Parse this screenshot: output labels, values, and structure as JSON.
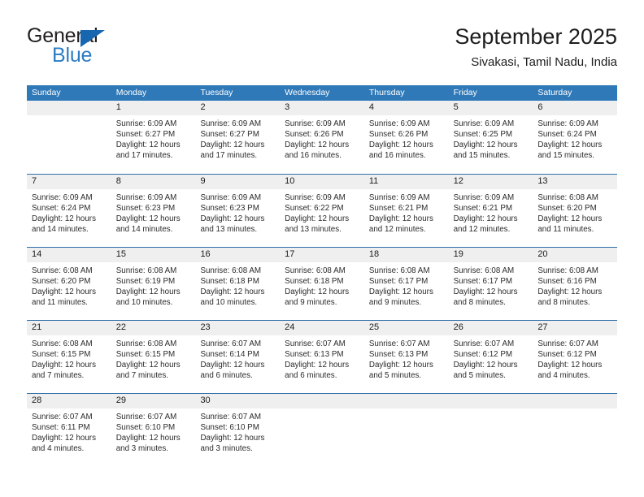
{
  "brand": {
    "name_top": "General",
    "name_bottom": "Blue",
    "triangle_color": "#1666b0",
    "blue_text_color": "#2b7cc4"
  },
  "header": {
    "title": "September 2025",
    "subtitle": "Sivakasi, Tamil Nadu, India"
  },
  "theme": {
    "header_bg": "#3079b8",
    "header_text": "#ffffff",
    "row_divider": "#2f6fa8",
    "daystrip_bg": "#efefef",
    "body_text": "#2b2b2b"
  },
  "calendar": {
    "weekdays": [
      "Sunday",
      "Monday",
      "Tuesday",
      "Wednesday",
      "Thursday",
      "Friday",
      "Saturday"
    ],
    "weeks": [
      [
        {
          "day": "",
          "lines": []
        },
        {
          "day": "1",
          "lines": [
            "Sunrise: 6:09 AM",
            "Sunset: 6:27 PM",
            "Daylight: 12 hours",
            "and 17 minutes."
          ]
        },
        {
          "day": "2",
          "lines": [
            "Sunrise: 6:09 AM",
            "Sunset: 6:27 PM",
            "Daylight: 12 hours",
            "and 17 minutes."
          ]
        },
        {
          "day": "3",
          "lines": [
            "Sunrise: 6:09 AM",
            "Sunset: 6:26 PM",
            "Daylight: 12 hours",
            "and 16 minutes."
          ]
        },
        {
          "day": "4",
          "lines": [
            "Sunrise: 6:09 AM",
            "Sunset: 6:26 PM",
            "Daylight: 12 hours",
            "and 16 minutes."
          ]
        },
        {
          "day": "5",
          "lines": [
            "Sunrise: 6:09 AM",
            "Sunset: 6:25 PM",
            "Daylight: 12 hours",
            "and 15 minutes."
          ]
        },
        {
          "day": "6",
          "lines": [
            "Sunrise: 6:09 AM",
            "Sunset: 6:24 PM",
            "Daylight: 12 hours",
            "and 15 minutes."
          ]
        }
      ],
      [
        {
          "day": "7",
          "lines": [
            "Sunrise: 6:09 AM",
            "Sunset: 6:24 PM",
            "Daylight: 12 hours",
            "and 14 minutes."
          ]
        },
        {
          "day": "8",
          "lines": [
            "Sunrise: 6:09 AM",
            "Sunset: 6:23 PM",
            "Daylight: 12 hours",
            "and 14 minutes."
          ]
        },
        {
          "day": "9",
          "lines": [
            "Sunrise: 6:09 AM",
            "Sunset: 6:23 PM",
            "Daylight: 12 hours",
            "and 13 minutes."
          ]
        },
        {
          "day": "10",
          "lines": [
            "Sunrise: 6:09 AM",
            "Sunset: 6:22 PM",
            "Daylight: 12 hours",
            "and 13 minutes."
          ]
        },
        {
          "day": "11",
          "lines": [
            "Sunrise: 6:09 AM",
            "Sunset: 6:21 PM",
            "Daylight: 12 hours",
            "and 12 minutes."
          ]
        },
        {
          "day": "12",
          "lines": [
            "Sunrise: 6:09 AM",
            "Sunset: 6:21 PM",
            "Daylight: 12 hours",
            "and 12 minutes."
          ]
        },
        {
          "day": "13",
          "lines": [
            "Sunrise: 6:08 AM",
            "Sunset: 6:20 PM",
            "Daylight: 12 hours",
            "and 11 minutes."
          ]
        }
      ],
      [
        {
          "day": "14",
          "lines": [
            "Sunrise: 6:08 AM",
            "Sunset: 6:20 PM",
            "Daylight: 12 hours",
            "and 11 minutes."
          ]
        },
        {
          "day": "15",
          "lines": [
            "Sunrise: 6:08 AM",
            "Sunset: 6:19 PM",
            "Daylight: 12 hours",
            "and 10 minutes."
          ]
        },
        {
          "day": "16",
          "lines": [
            "Sunrise: 6:08 AM",
            "Sunset: 6:18 PM",
            "Daylight: 12 hours",
            "and 10 minutes."
          ]
        },
        {
          "day": "17",
          "lines": [
            "Sunrise: 6:08 AM",
            "Sunset: 6:18 PM",
            "Daylight: 12 hours",
            "and 9 minutes."
          ]
        },
        {
          "day": "18",
          "lines": [
            "Sunrise: 6:08 AM",
            "Sunset: 6:17 PM",
            "Daylight: 12 hours",
            "and 9 minutes."
          ]
        },
        {
          "day": "19",
          "lines": [
            "Sunrise: 6:08 AM",
            "Sunset: 6:17 PM",
            "Daylight: 12 hours",
            "and 8 minutes."
          ]
        },
        {
          "day": "20",
          "lines": [
            "Sunrise: 6:08 AM",
            "Sunset: 6:16 PM",
            "Daylight: 12 hours",
            "and 8 minutes."
          ]
        }
      ],
      [
        {
          "day": "21",
          "lines": [
            "Sunrise: 6:08 AM",
            "Sunset: 6:15 PM",
            "Daylight: 12 hours",
            "and 7 minutes."
          ]
        },
        {
          "day": "22",
          "lines": [
            "Sunrise: 6:08 AM",
            "Sunset: 6:15 PM",
            "Daylight: 12 hours",
            "and 7 minutes."
          ]
        },
        {
          "day": "23",
          "lines": [
            "Sunrise: 6:07 AM",
            "Sunset: 6:14 PM",
            "Daylight: 12 hours",
            "and 6 minutes."
          ]
        },
        {
          "day": "24",
          "lines": [
            "Sunrise: 6:07 AM",
            "Sunset: 6:13 PM",
            "Daylight: 12 hours",
            "and 6 minutes."
          ]
        },
        {
          "day": "25",
          "lines": [
            "Sunrise: 6:07 AM",
            "Sunset: 6:13 PM",
            "Daylight: 12 hours",
            "and 5 minutes."
          ]
        },
        {
          "day": "26",
          "lines": [
            "Sunrise: 6:07 AM",
            "Sunset: 6:12 PM",
            "Daylight: 12 hours",
            "and 5 minutes."
          ]
        },
        {
          "day": "27",
          "lines": [
            "Sunrise: 6:07 AM",
            "Sunset: 6:12 PM",
            "Daylight: 12 hours",
            "and 4 minutes."
          ]
        }
      ],
      [
        {
          "day": "28",
          "lines": [
            "Sunrise: 6:07 AM",
            "Sunset: 6:11 PM",
            "Daylight: 12 hours",
            "and 4 minutes."
          ]
        },
        {
          "day": "29",
          "lines": [
            "Sunrise: 6:07 AM",
            "Sunset: 6:10 PM",
            "Daylight: 12 hours",
            "and 3 minutes."
          ]
        },
        {
          "day": "30",
          "lines": [
            "Sunrise: 6:07 AM",
            "Sunset: 6:10 PM",
            "Daylight: 12 hours",
            "and 3 minutes."
          ]
        },
        {
          "day": "",
          "lines": []
        },
        {
          "day": "",
          "lines": []
        },
        {
          "day": "",
          "lines": []
        },
        {
          "day": "",
          "lines": []
        }
      ]
    ]
  }
}
